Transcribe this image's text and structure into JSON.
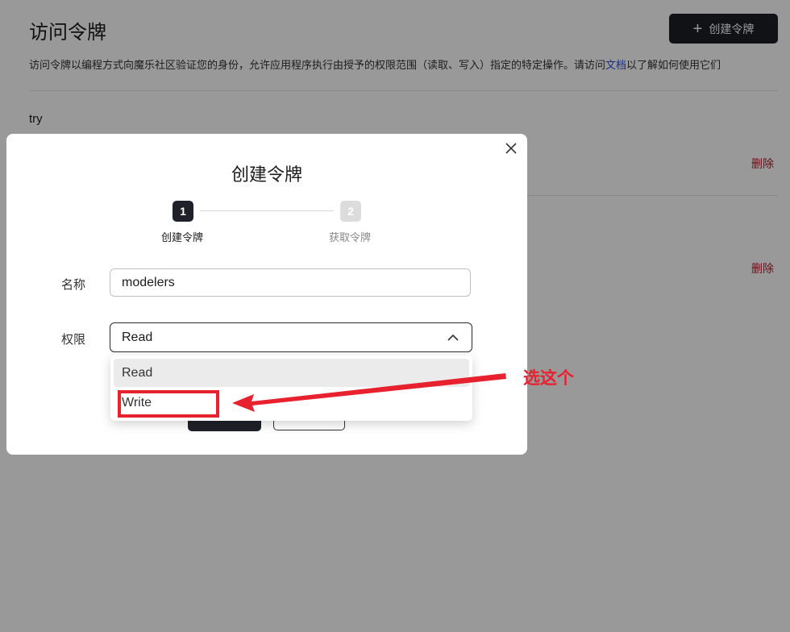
{
  "page": {
    "title": "访问令牌",
    "create_button": "创建令牌",
    "description_prefix": "访问令牌以编程方式向魔乐社区验证您的身份，允许应用程序执行由授予的权限范围（读取、写入）指定的特定操作。请访问",
    "description_link": "文档",
    "description_suffix": "以了解如何使用它们",
    "tokens": [
      {
        "name": "try",
        "delete_label": "删除"
      },
      {
        "name": "",
        "delete_label": "删除"
      }
    ]
  },
  "modal": {
    "title": "创建令牌",
    "steps": [
      {
        "number": "1",
        "label": "创建令牌",
        "state": "active"
      },
      {
        "number": "2",
        "label": "获取令牌",
        "state": "pending"
      }
    ],
    "name_label": "名称",
    "name_value": "modelers",
    "permission_label": "权限",
    "permission_value": "Read",
    "permission_options": [
      "Read",
      "Write"
    ],
    "permission_selected": "Read"
  },
  "annotation": {
    "text": "选这个",
    "target": "Write",
    "color": "#e8212f"
  },
  "colors": {
    "primary_dark": "#1e2129",
    "danger": "#c0152a",
    "link": "#2d4fd1",
    "annotation_red": "#e8212f"
  },
  "icons": {
    "create": "plus-icon",
    "close": "close-icon",
    "select": "chevron-up-icon"
  }
}
